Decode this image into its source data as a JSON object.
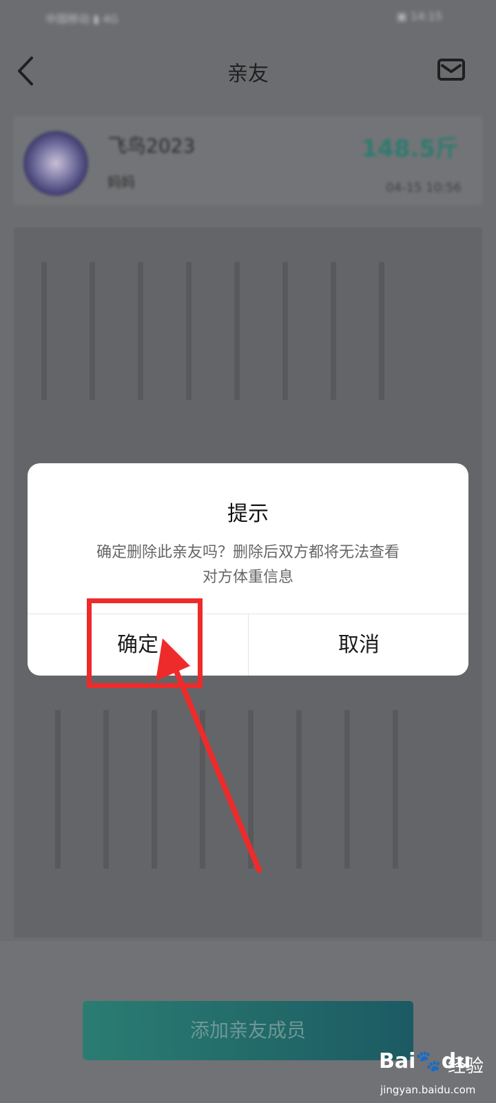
{
  "statusbar": {
    "left": "中国移动 ▮ 4G",
    "right": "▣ 14:15"
  },
  "navbar": {
    "title": "亲友"
  },
  "profile": {
    "name": "飞鸟2023",
    "relation": "妈妈",
    "weight": "148.5斤",
    "date": "04-15 10:56"
  },
  "dialog": {
    "title": "提示",
    "message_line1": "确定删除此亲友吗？删除后双方都将无法查看",
    "message_line2": "对方体重信息",
    "confirm_label": "确定",
    "cancel_label": "取消"
  },
  "bottom": {
    "add_label": "添加亲友成员"
  },
  "watermark": {
    "logo": "Bai🐾du",
    "text": "经验",
    "url": "jingyan.baidu.com"
  },
  "colors": {
    "highlight": "#ee2b2b",
    "accent": "#2a7d72"
  }
}
